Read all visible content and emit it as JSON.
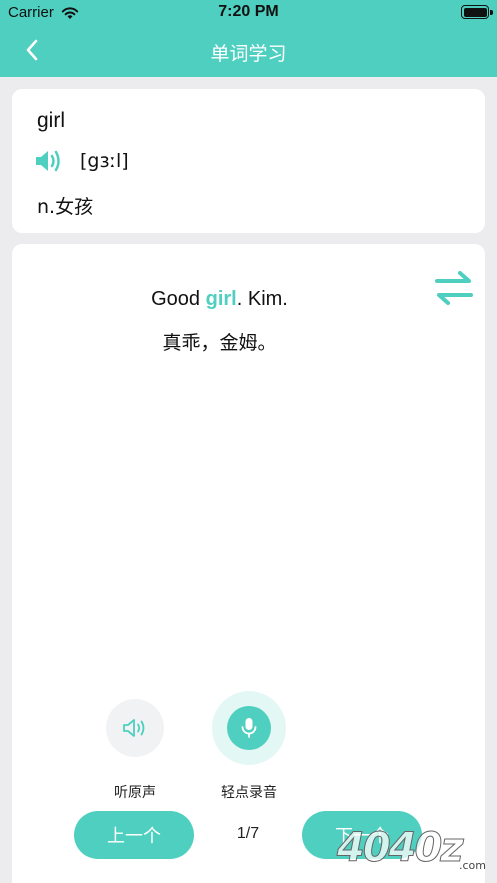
{
  "status_bar": {
    "carrier": "Carrier",
    "time": "7:20 PM"
  },
  "nav": {
    "title": "单词学习"
  },
  "word_card": {
    "word": "girl",
    "phonetic": "[gɜːl]",
    "meaning": "n.女孩"
  },
  "sentence": {
    "en_before": "Good ",
    "en_highlight": "girl",
    "en_after": ". Kim.",
    "cn": "真乖，金姆。"
  },
  "controls": {
    "play_original_label": "听原声",
    "record_label": "轻点录音"
  },
  "pager": {
    "prev_label": "上一个",
    "next_label": "下一个",
    "indicator": "1/7"
  },
  "watermark": {
    "text": "4040z.com"
  },
  "colors": {
    "accent": "#4fcfc0",
    "background": "#ececef"
  }
}
